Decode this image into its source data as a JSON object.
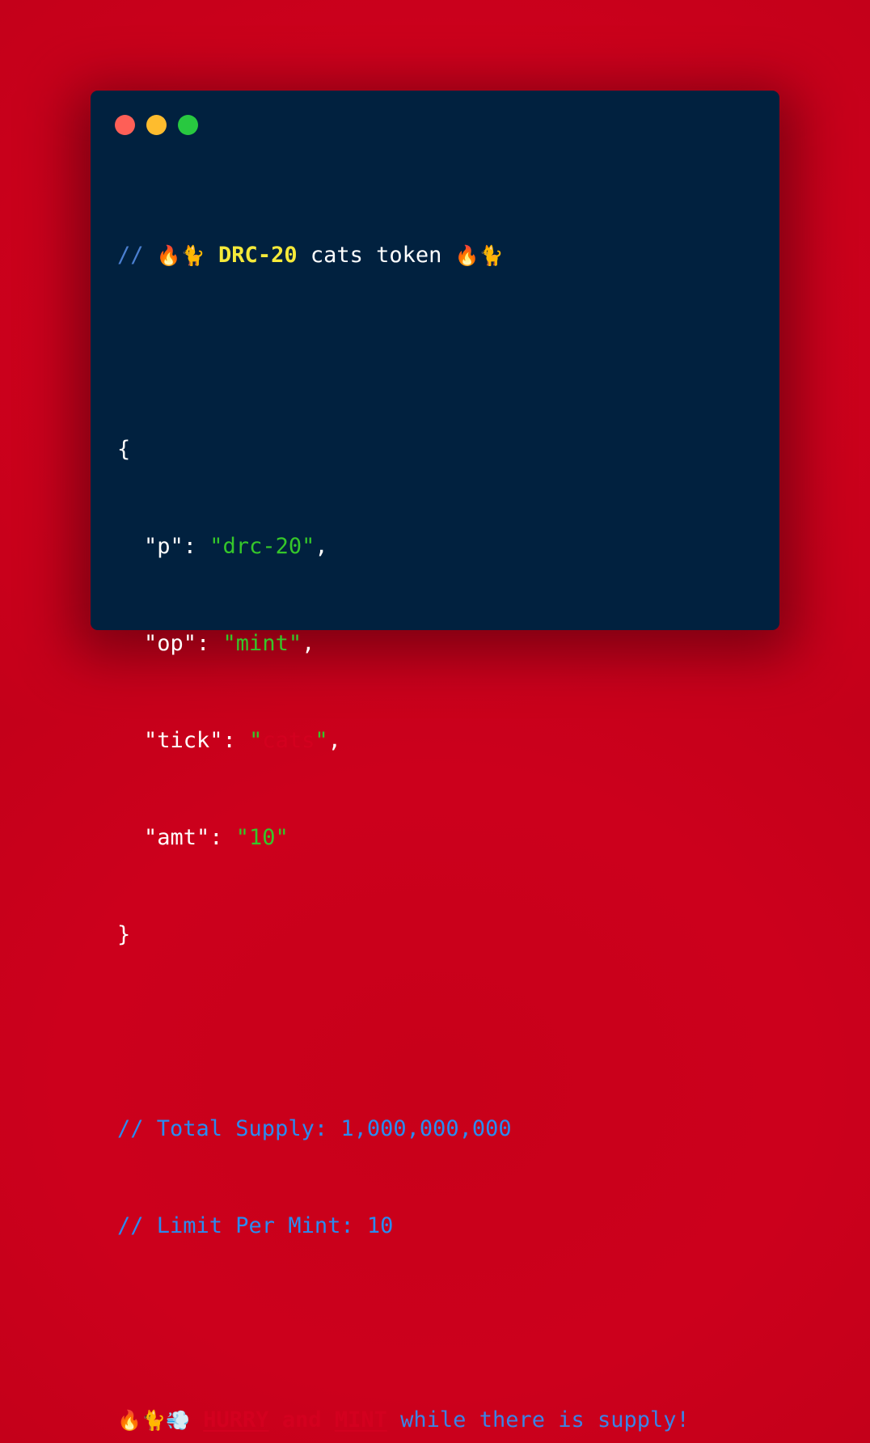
{
  "colors": {
    "background": "#cc001c",
    "window": "#01213f",
    "traffic_red": "#fe5f57",
    "traffic_yellow": "#febc2e",
    "traffic_green": "#28c840",
    "comment_blue": "#2a8cf0",
    "accent_yellow": "#f5e93a",
    "string_green": "#35c72a",
    "string_red": "#d3001f"
  },
  "header_comment": {
    "slashes": "//",
    "emoji_fire": "🔥",
    "emoji_cat": "🐈",
    "highlight": "DRC-20",
    "text": "cats token"
  },
  "json_block": {
    "open_brace": "{",
    "close_brace": "}",
    "lines": [
      {
        "key": "\"p\"",
        "value": "\"drc-20\"",
        "trailing": ","
      },
      {
        "key": "\"op\"",
        "value": "\"mint\"",
        "trailing": ","
      },
      {
        "key": "\"tick\"",
        "value_quote_open": "\"",
        "value_inner": "cats",
        "value_quote_close": "\"",
        "trailing": ","
      },
      {
        "key": "\"amt\"",
        "value": "\"10\"",
        "trailing": ""
      }
    ]
  },
  "info_comments": [
    "// Total Supply: 1,000,000,000",
    "// Limit Per Mint: 10"
  ],
  "footer": {
    "emoji_fire": "🔥",
    "emoji_cat": "🐈",
    "emoji_dash": "💨",
    "word_hurry": "HURRY",
    "word_and": "and",
    "word_mint": "MINT",
    "rest": "while there is supply!"
  }
}
